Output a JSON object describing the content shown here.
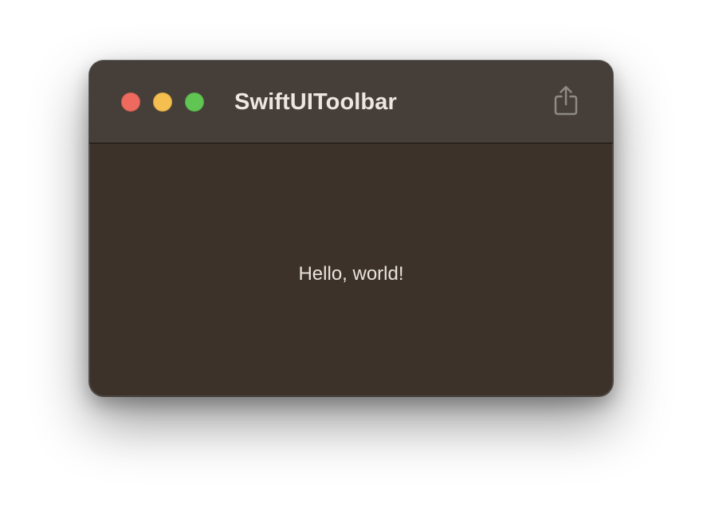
{
  "window": {
    "title": "SwiftUIToolbar",
    "controls": {
      "close_color": "#ee6a5e",
      "minimize_color": "#f5bf4f",
      "zoom_color": "#61c554"
    },
    "toolbar": {
      "share_icon": "share-icon"
    }
  },
  "content": {
    "text": "Hello, world!"
  },
  "colors": {
    "toolbar_bg": "#463f39",
    "content_bg": "#3d3229",
    "text": "#e9e3dd"
  }
}
